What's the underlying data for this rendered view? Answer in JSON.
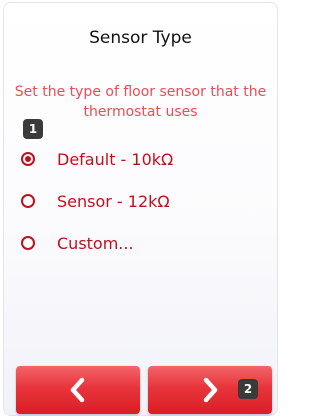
{
  "screen": {
    "title": "Sensor Type",
    "subtitle": "Set the type of floor sensor that the thermostat uses"
  },
  "badges": [
    "1",
    "2"
  ],
  "options": [
    {
      "label": "Default - 10kΩ",
      "selected": true
    },
    {
      "label": "Sensor - 12kΩ",
      "selected": false
    },
    {
      "label": "Custom...",
      "selected": false
    }
  ],
  "buttons": {
    "back_icon": "chevron-left-icon",
    "next_icon": "chevron-right-icon"
  },
  "colors": {
    "accent": "#c01020",
    "subtitle": "#e84c57",
    "button": "#e8343b"
  }
}
